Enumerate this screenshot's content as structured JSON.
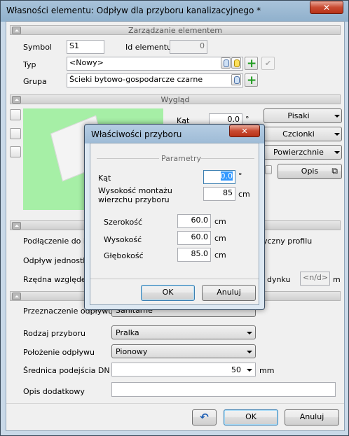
{
  "window": {
    "title": "Własności elementu: Odpływ dla przyboru kanalizacyjnego *",
    "close_label": "✕"
  },
  "sections": {
    "element": "Zarządzanie elementem",
    "look": "Wygląd"
  },
  "element": {
    "symbol_label": "Symbol",
    "symbol_value": "S1",
    "id_label": "Id elementu",
    "id_value": "0",
    "type_label": "Typ",
    "type_value": "<Nowy>",
    "group_label": "Grupa",
    "group_value": "Ścieki bytowo-gospodarcze czarne"
  },
  "look": {
    "angle_label": "Kąt",
    "angle_value": "0.0",
    "angle_unit": "°",
    "pens_button": "Pisaki",
    "fonts_button": "Czcionki",
    "surfaces_button": "Powierzchnie",
    "describe_button": "Opis"
  },
  "background_fragments": {
    "connect_label": "Podłączenie do ins",
    "profile_label": "yczny profilu",
    "unit_outflow_label": "Odpływ jednostko",
    "ordinate_label": "Rzędna względem",
    "building_label": "dynku",
    "ordinate_value": "<n/d>",
    "ordinate_unit": "m",
    "purpose_label": "Przeznaczenie odpływu",
    "purpose_value": "Sanitarne"
  },
  "params": {
    "fixture_type_label": "Rodzaj przyboru",
    "fixture_type_value": "Pralka",
    "outflow_position_label": "Położenie odpływu",
    "outflow_position_value": "Pionowy",
    "dn_label": "Średnica podejścia DN",
    "dn_value": "50",
    "dn_unit": "mm",
    "extra_desc_label": "Opis dodatkowy",
    "extra_desc_value": ""
  },
  "footer": {
    "ok": "OK",
    "cancel": "Anuluj"
  },
  "dialog": {
    "title": "Właściwości przyboru",
    "close_label": "✕",
    "group_label": "Parametry",
    "angle_label": "Kąt",
    "angle_value": "0.0",
    "angle_unit": "°",
    "mount_height_label_1": "Wysokość montażu",
    "mount_height_label_2": "wierzchu przyboru",
    "mount_height_value": "85",
    "mount_height_unit": "cm",
    "width_label": "Szerokość",
    "width_value": "60.0",
    "width_unit": "cm",
    "height_label": "Wysokość",
    "height_value": "60.0",
    "height_unit": "cm",
    "depth_label": "Głębokość",
    "depth_value": "85.0",
    "depth_unit": "cm",
    "ok": "OK",
    "cancel": "Anuluj"
  },
  "colors": {
    "preview_bg": "#a6efa6",
    "plus_green": "#1e9b1e",
    "close_red": "#c94b32"
  }
}
